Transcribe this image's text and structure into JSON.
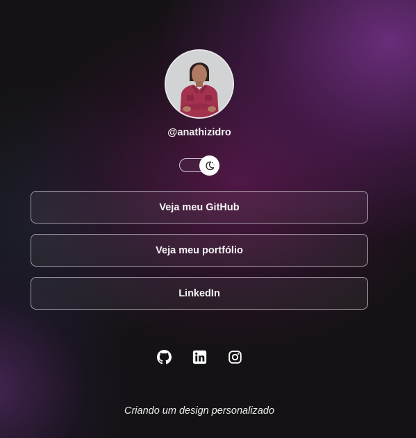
{
  "profile": {
    "username": "@anathizidro",
    "avatar_alt": "Foto de perfil"
  },
  "theme_toggle": {
    "icon": "moon-stars-icon",
    "state": "dark"
  },
  "links": [
    {
      "label": "Veja meu GitHub"
    },
    {
      "label": "Veja meu portfólio"
    },
    {
      "label": "LinkedIn"
    }
  ],
  "socials": [
    {
      "icon": "github-icon"
    },
    {
      "icon": "linkedin-icon"
    },
    {
      "icon": "instagram-icon"
    }
  ],
  "footer": {
    "text": "Criando um design personalizado"
  },
  "colors": {
    "background": "#141214",
    "accent_purple": "#783c8c",
    "button_border": "#a99aa9",
    "text": "#ffffff"
  }
}
